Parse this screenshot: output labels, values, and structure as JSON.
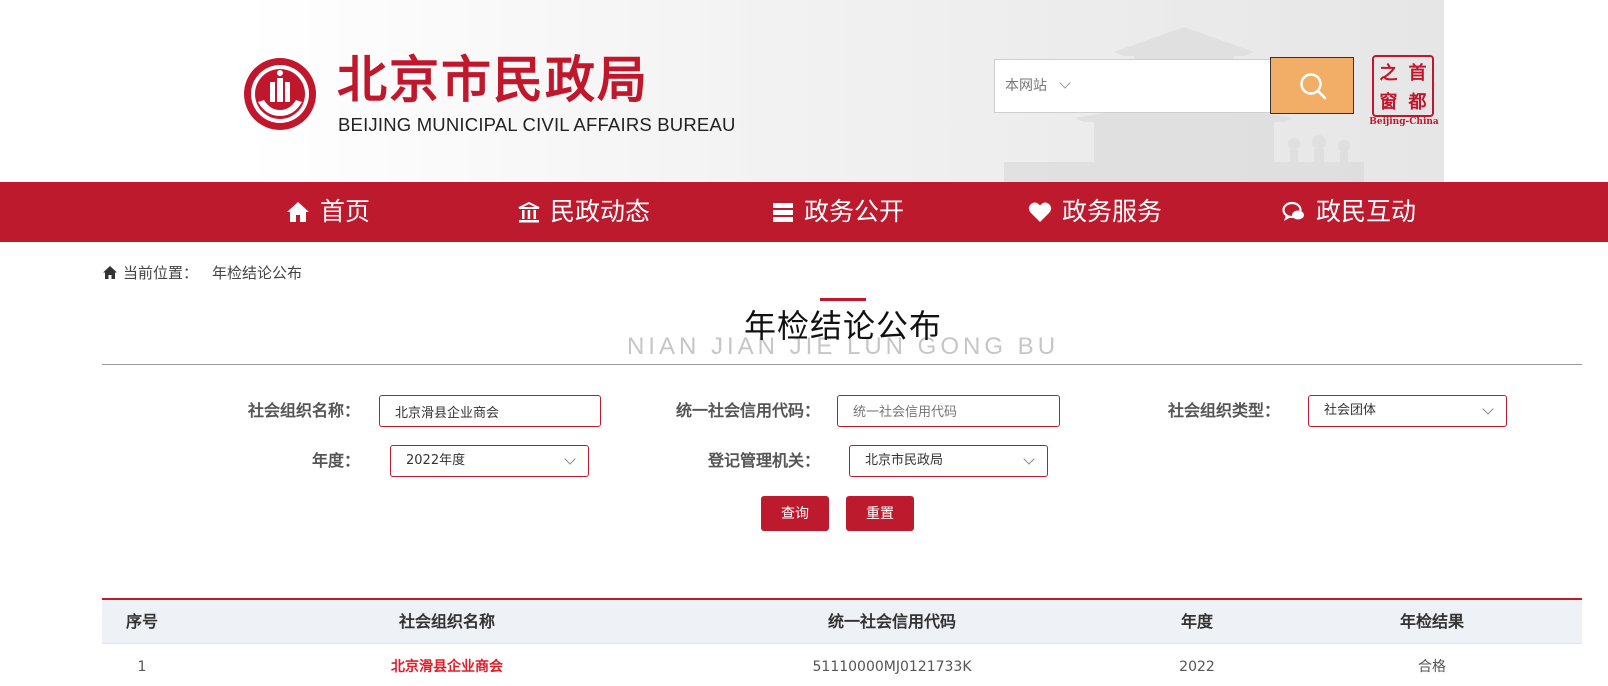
{
  "header": {
    "brand_cn": "北京市民政局",
    "brand_en": "BEIJING MUNICIPAL CIVIL AFFAIRS BUREAU",
    "search_scope": "本网站",
    "search_placeholder": "",
    "seal_chars": [
      "之",
      "首",
      "窗",
      "都"
    ],
    "seal_sub": "Beijing-China",
    "accent": "#be1a2e",
    "search_button_color": "#f2ae66"
  },
  "nav": {
    "items": [
      {
        "label": "首页",
        "icon": "home-icon"
      },
      {
        "label": "民政动态",
        "icon": "building-icon"
      },
      {
        "label": "政务公开",
        "icon": "document-stack-icon"
      },
      {
        "label": "政务服务",
        "icon": "heart-icon"
      },
      {
        "label": "政民互动",
        "icon": "chat-icon"
      }
    ]
  },
  "breadcrumb": {
    "prefix": "当前位置：",
    "current": "年检结论公布"
  },
  "title": {
    "cn": "年检结论公布",
    "en": "NIAN JIAN JIE LUN GONG BU"
  },
  "filters": {
    "org_name_label": "社会组织名称：",
    "org_name_value": "北京滑县企业商会",
    "credit_code_label": "统一社会信用代码：",
    "credit_code_placeholder": "统一社会信用代码",
    "org_type_label": "社会组织类型：",
    "org_type_value": "社会团体",
    "year_label": "年度：",
    "year_value": "2022年度",
    "authority_label": "登记管理机关：",
    "authority_value": "北京市民政局",
    "query_button": "查询",
    "reset_button": "重置"
  },
  "table": {
    "headers": [
      "序号",
      "社会组织名称",
      "统一社会信用代码",
      "年度",
      "年检结果"
    ],
    "rows": [
      [
        "1",
        "北京滑县企业商会",
        "51110000MJ0121733K",
        "2022",
        "合格"
      ]
    ]
  }
}
